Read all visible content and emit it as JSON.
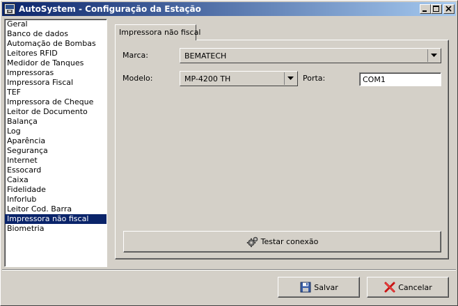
{
  "window": {
    "title": "AutoSystem - Configuração da Estação",
    "buttons": {
      "minimize": "minimize",
      "maximize": "maximize",
      "close": "close"
    }
  },
  "sidebar": {
    "selected_index": 21,
    "items": [
      {
        "label": "Geral"
      },
      {
        "label": "Banco de dados"
      },
      {
        "label": "Automação de Bombas"
      },
      {
        "label": "Leitores RFID"
      },
      {
        "label": "Medidor de Tanques"
      },
      {
        "label": "Impressoras"
      },
      {
        "label": "Impressora Fiscal"
      },
      {
        "label": "TEF"
      },
      {
        "label": "Impressora de Cheque"
      },
      {
        "label": "Leitor de Documento"
      },
      {
        "label": "Balança"
      },
      {
        "label": "Log"
      },
      {
        "label": "Aparência"
      },
      {
        "label": "Segurança"
      },
      {
        "label": "Internet"
      },
      {
        "label": "Essocard"
      },
      {
        "label": "Caixa"
      },
      {
        "label": "Fidelidade"
      },
      {
        "label": "Inforlub"
      },
      {
        "label": "Leitor Cod. Barra"
      },
      {
        "label": "Impressora não fiscal"
      },
      {
        "label": "Biometria"
      }
    ]
  },
  "panel": {
    "tab_label": "Impressora não fiscal",
    "marca": {
      "label": "Marca:",
      "value": "BEMATECH"
    },
    "modelo": {
      "label": "Modelo:",
      "value": "MP-4200 TH"
    },
    "porta": {
      "label": "Porta:",
      "value": "COM1"
    },
    "test_button": {
      "label": "Testar conexão",
      "icon": "gears-icon"
    }
  },
  "footer": {
    "save": {
      "label": "Salvar",
      "icon": "floppy-disk-icon"
    },
    "cancel": {
      "label": "Cancelar",
      "icon": "red-x-icon"
    }
  },
  "colors": {
    "selection": "#0a246a",
    "titlebar_start": "#0a246a",
    "titlebar_end": "#a6caf0",
    "face": "#d4d0c8"
  }
}
